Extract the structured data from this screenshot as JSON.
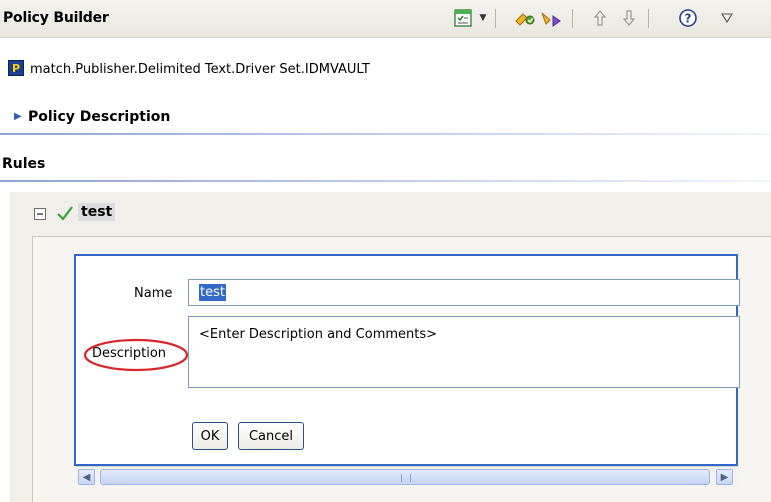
{
  "app": {
    "title": "Policy Builder"
  },
  "path": {
    "icon_letter": "P",
    "text": "match.Publisher.Delimited Text.Driver Set.IDMVAULT"
  },
  "sections": {
    "policy_description": "Policy Description",
    "rules": "Rules"
  },
  "rule": {
    "name": "test",
    "status": "enabled-checkmark"
  },
  "form": {
    "name_label": "Name",
    "name_value": "test",
    "description_label": "Description",
    "description_placeholder": "<Enter Description and Comments>",
    "ok_label": "OK",
    "cancel_label": "Cancel"
  },
  "toolbar_icons": [
    "edit-list-icon",
    "dropdown-arrow-icon",
    "add-rule-icon",
    "rule-group-icon",
    "move-up-icon",
    "move-down-icon",
    "help-icon",
    "view-menu-icon"
  ],
  "colors": {
    "accent": "#3167c7",
    "selection": "#316ac5",
    "annotation_circle": "#d9262a",
    "check_green": "#3aa335"
  }
}
